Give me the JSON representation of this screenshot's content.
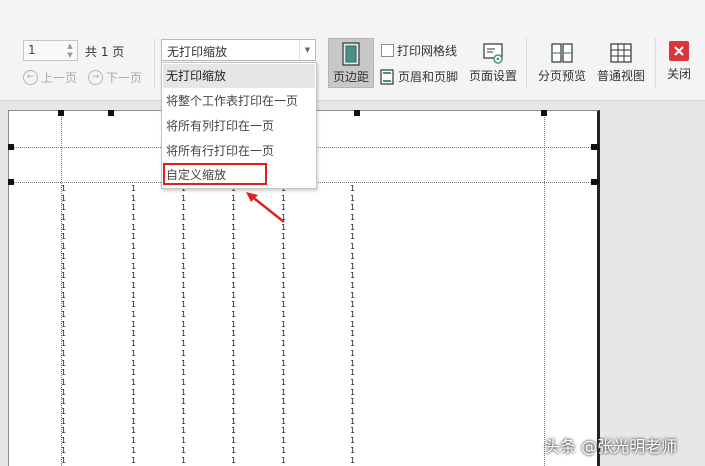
{
  "toolbar": {
    "page_input": {
      "value": "1"
    },
    "total_pages": "共 1 页",
    "prev_page": "上一页",
    "next_page": "下一页",
    "zoom": {
      "selected": "无打印缩放",
      "options": [
        "无打印缩放",
        "将整个工作表打印在一页",
        "将所有列打印在一页",
        "将所有行打印在一页",
        "自定义缩放"
      ]
    },
    "margins": "页边距",
    "print_gridlines": "打印网格线",
    "header_footer": "页眉和页脚",
    "page_setup": "页面设置",
    "page_break_preview": "分页预览",
    "normal_view": "普通视图",
    "close": "关闭"
  },
  "sheet": {
    "cell_value": "1"
  },
  "colors": {
    "highlight": "#e02020",
    "arrow": "#e02020",
    "close": "#d9363e"
  },
  "watermark": "头条 @张光明老师"
}
